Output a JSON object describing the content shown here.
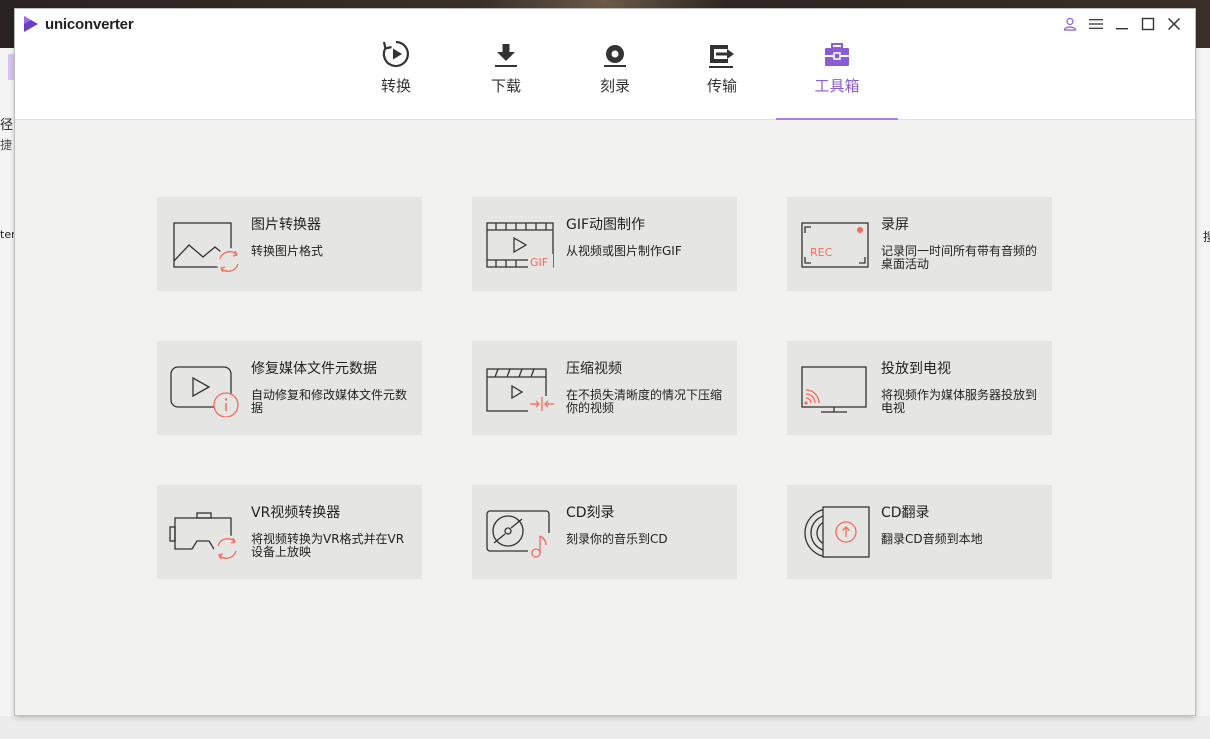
{
  "app": {
    "name": "uniconverter"
  },
  "background": {
    "left_fragments": [
      "径",
      "捷",
      "ter"
    ],
    "right_fragments": [
      "搜"
    ]
  },
  "nav": {
    "tabs": [
      {
        "label": "转换",
        "icon": "convert-icon"
      },
      {
        "label": "下载",
        "icon": "download-icon"
      },
      {
        "label": "刻录",
        "icon": "burn-disc-icon"
      },
      {
        "label": "传输",
        "icon": "transfer-icon"
      },
      {
        "label": "工具箱",
        "icon": "toolbox-icon",
        "active": true
      }
    ]
  },
  "window_controls": [
    "user-icon",
    "menu-icon",
    "minimize-icon",
    "maximize-icon",
    "close-icon"
  ],
  "accent_color": "#8a5cd6",
  "highlight_color": "#f26b5b",
  "tools": [
    {
      "title": "图片转换器",
      "desc": "转换图片格式",
      "icon": "image-convert-icon"
    },
    {
      "title": "GIF动图制作",
      "desc": "从视频或图片制作GIF",
      "icon": "gif-maker-icon"
    },
    {
      "title": "录屏",
      "desc": "记录同一时间所有带有音频的桌面活动",
      "icon": "screen-record-icon"
    },
    {
      "title": "修复媒体文件元数据",
      "desc": "自动修复和修改媒体文件元数据",
      "icon": "metadata-fix-icon"
    },
    {
      "title": "压缩视频",
      "desc": "在不损失清晰度的情况下压缩你的视频",
      "icon": "compress-video-icon"
    },
    {
      "title": "投放到电视",
      "desc": "将视频作为媒体服务器投放到电视",
      "icon": "cast-tv-icon"
    },
    {
      "title": "VR视频转换器",
      "desc": "将视频转换为VR格式并在VR设备上放映",
      "icon": "vr-convert-icon"
    },
    {
      "title": "CD刻录",
      "desc": "刻录你的音乐到CD",
      "icon": "cd-burn-icon"
    },
    {
      "title": "CD翻录",
      "desc": "翻录CD音频到本地",
      "icon": "cd-rip-icon"
    }
  ]
}
